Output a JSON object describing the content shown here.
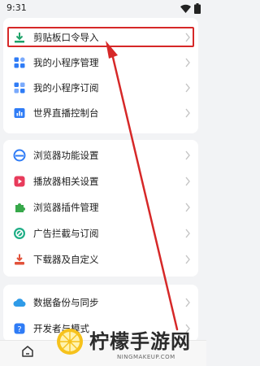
{
  "status_bar": {
    "time": "9:31",
    "icons": [
      "wifi-icon",
      "battery-icon"
    ]
  },
  "menu_group_1": [
    {
      "label": "剪贴板口令导入",
      "icon": "clipboard-import-icon",
      "color": "#1fa36a"
    },
    {
      "label": "我的小程序管理",
      "icon": "mini-program-icon",
      "color": "#2f7cf6"
    },
    {
      "label": "我的小程序订阅",
      "icon": "subscribe-icon",
      "color": "#2f7cf6"
    },
    {
      "label": "世界直播控制台",
      "icon": "live-console-icon",
      "color": "#2f7cf6"
    }
  ],
  "menu_group_2": [
    {
      "label": "浏览器功能设置",
      "icon": "browser-settings-icon",
      "color": "#2f7cf6"
    },
    {
      "label": "播放器相关设置",
      "icon": "player-icon",
      "color": "#e83b5b"
    },
    {
      "label": "浏览器插件管理",
      "icon": "plugin-icon",
      "color": "#37a84a"
    },
    {
      "label": "广告拦截与订阅",
      "icon": "adblock-icon",
      "color": "#1fae86"
    },
    {
      "label": "下载器及自定义",
      "icon": "download-icon",
      "color": "#e2523a"
    }
  ],
  "menu_group_3": [
    {
      "label": "数据备份与同步",
      "icon": "cloud-backup-icon",
      "color": "#2f9be8"
    },
    {
      "label": "开发者与模式",
      "icon": "developer-icon",
      "color": "#2f7cf6"
    }
  ],
  "bottom_bar": {
    "icons": [
      "home-icon"
    ]
  },
  "watermark": {
    "title": "柠檬手游网",
    "subtitle": "NINGMAKEUP.COM"
  },
  "colors": {
    "annotation_red": "#d62828",
    "background": "#f2f3f5",
    "card": "#ffffff"
  }
}
